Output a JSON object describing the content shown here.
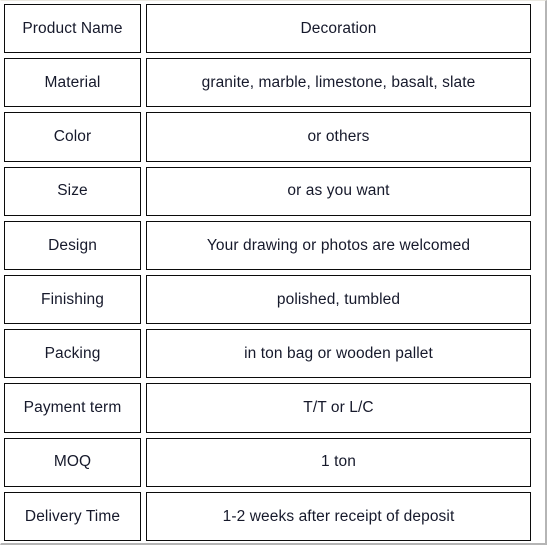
{
  "table": {
    "rows": [
      {
        "label": "Product Name",
        "value": "Decoration"
      },
      {
        "label": "Material",
        "value": "granite, marble, limestone, basalt, slate"
      },
      {
        "label": "Color",
        "value": "or others"
      },
      {
        "label": "Size",
        "value": "or as you want"
      },
      {
        "label": "Design",
        "value": "Your drawing or photos are welcomed"
      },
      {
        "label": "Finishing",
        "value": "polished, tumbled"
      },
      {
        "label": "Packing",
        "value": "in ton bag or wooden pallet"
      },
      {
        "label": "Payment term",
        "value": "T/T or L/C"
      },
      {
        "label": "MOQ",
        "value": "1 ton"
      },
      {
        "label": "Delivery Time",
        "value": "1-2 weeks after receipt of deposit"
      }
    ]
  },
  "colors": {
    "text": "#16192b",
    "cell_border": "#0b0b0b",
    "frame_line": "#b5b5b5",
    "background": "#ffffff"
  }
}
